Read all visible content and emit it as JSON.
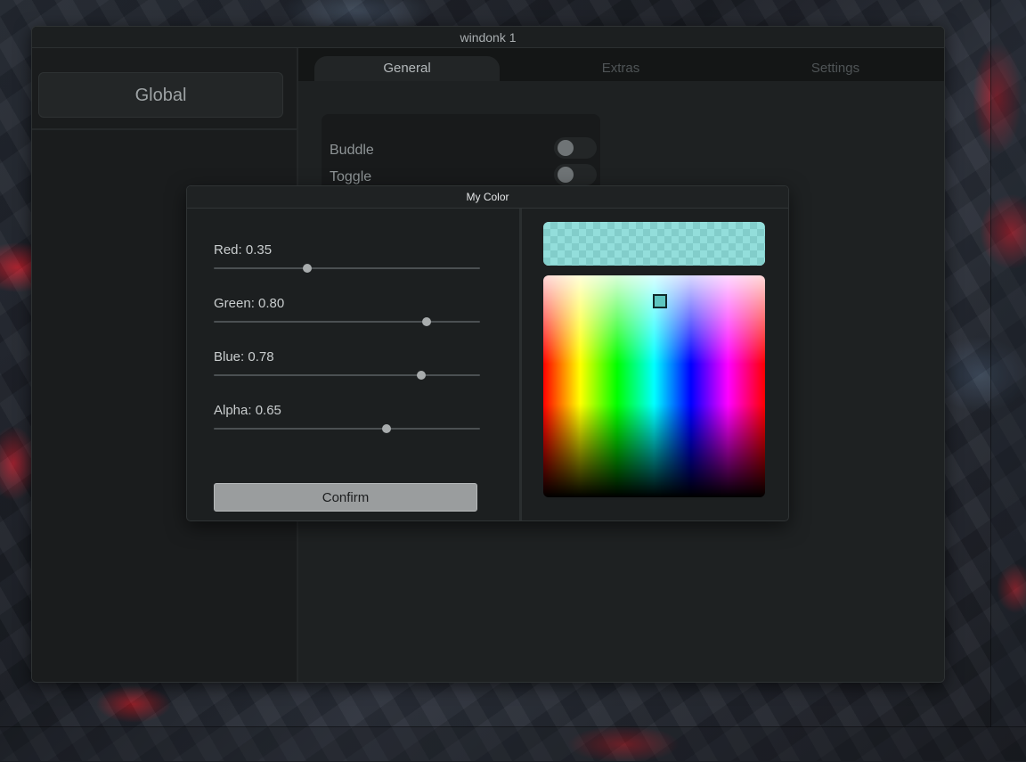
{
  "window": {
    "title": "windonk 1"
  },
  "sidebar": {
    "global_label": "Global"
  },
  "tabs": [
    {
      "label": "General",
      "active": true
    },
    {
      "label": "Extras",
      "active": false
    },
    {
      "label": "Settings",
      "active": false
    }
  ],
  "general": {
    "settings": [
      {
        "label": "Buddle",
        "enabled": false
      },
      {
        "label": "Toggle",
        "enabled": false
      }
    ]
  },
  "color_dialog": {
    "title": "My Color",
    "sliders": [
      {
        "label": "Red: 0.35",
        "value": 0.35
      },
      {
        "label": "Green: 0.80",
        "value": 0.8
      },
      {
        "label": "Blue: 0.78",
        "value": 0.78
      },
      {
        "label": "Alpha: 0.65",
        "value": 0.65
      }
    ],
    "confirm_label": "Confirm",
    "preview_color": "rgba(89, 204, 199, 0.65)"
  }
}
